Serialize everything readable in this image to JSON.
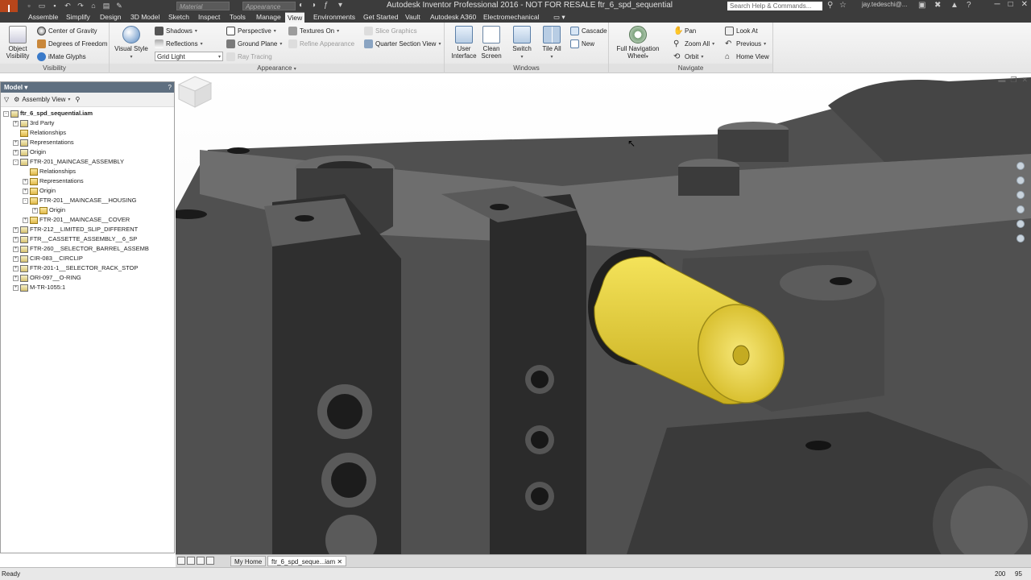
{
  "titlebar": {
    "logo": "I",
    "material_placeholder": "Material",
    "appearance_placeholder": "Appearance",
    "title": "Autodesk Inventor Professional 2016 - NOT FOR RESALE    ftr_6_spd_sequential",
    "search_placeholder": "Search Help & Commands...",
    "user": "jay.tedeschi@..."
  },
  "tabs": [
    "Assemble",
    "Simplify",
    "Design",
    "3D Model",
    "Sketch",
    "Inspect",
    "Tools",
    "Manage",
    "View",
    "Environments",
    "Get Started",
    "Vault",
    "Autodesk A360",
    "Electromechanical"
  ],
  "active_tab": "View",
  "ribbon": {
    "visibility": {
      "title": "Visibility",
      "object_visibility": "Object Visibility",
      "center_of_gravity": "Center of Gravity",
      "degrees_of_freedom": "Degrees of Freedom",
      "imate_glyphs": "iMate Glyphs"
    },
    "appearance": {
      "title": "Appearance",
      "visual_style": "Visual Style",
      "shadows": "Shadows",
      "reflections": "Reflections",
      "grid_light": "Grid Light",
      "perspective": "Perspective",
      "ground_plane": "Ground Plane",
      "ray_tracing": "Ray Tracing",
      "textures_on": "Textures On",
      "refine_appearance": "Refine Appearance",
      "slice_graphics": "Slice Graphics",
      "quarter_section_view": "Quarter Section View"
    },
    "windows": {
      "title": "Windows",
      "user_interface": "User Interface",
      "clean_screen": "Clean Screen",
      "switch": "Switch",
      "tile_all": "Tile All",
      "cascade": "Cascade",
      "new": "New"
    },
    "navigate": {
      "title": "Navigate",
      "full_navigation_wheel": "Full Navigation Wheel",
      "pan": "Pan",
      "zoom_all": "Zoom All",
      "orbit": "Orbit",
      "look_at": "Look At",
      "previous": "Previous",
      "home_view": "Home View"
    }
  },
  "browser": {
    "title": "Model",
    "view_mode": "Assembly View",
    "nodes": [
      {
        "label": "ftr_6_spd_sequential.iam",
        "level": 0,
        "pm": "-",
        "bold": true
      },
      {
        "label": "3rd Party",
        "level": 1,
        "pm": "+"
      },
      {
        "label": "Relationships",
        "level": 1,
        "pm": ""
      },
      {
        "label": "Representations",
        "level": 1,
        "pm": "+"
      },
      {
        "label": "Origin",
        "level": 1,
        "pm": "+"
      },
      {
        "label": "FTR-201_MAINCASE_ASSEMBLY",
        "level": 1,
        "pm": "-"
      },
      {
        "label": "Relationships",
        "level": 2,
        "pm": ""
      },
      {
        "label": "Representations",
        "level": 2,
        "pm": "+"
      },
      {
        "label": "Origin",
        "level": 2,
        "pm": "+"
      },
      {
        "label": "FTR-201__MAINCASE__HOUSING",
        "level": 2,
        "pm": "-"
      },
      {
        "label": "Origin",
        "level": 3,
        "pm": "+"
      },
      {
        "label": "FTR-201__MAINCASE__COVER",
        "level": 2,
        "pm": "+"
      },
      {
        "label": "FTR-212__LIMITED_SLIP_DIFFERENT",
        "level": 1,
        "pm": "+"
      },
      {
        "label": "FTR__CASSETTE_ASSEMBLY__6_SP",
        "level": 1,
        "pm": "+"
      },
      {
        "label": "FTR-260__SELECTOR_BARREL_ASSEMB",
        "level": 1,
        "pm": "+"
      },
      {
        "label": "CIR-083__CIRCLIP",
        "level": 1,
        "pm": "+"
      },
      {
        "label": "FTR-201-1__SELECTOR_RACK_STOP",
        "level": 1,
        "pm": "+"
      },
      {
        "label": "ORI-097__O-RING",
        "level": 1,
        "pm": "+"
      },
      {
        "label": "M-TR-1055:1",
        "level": 1,
        "pm": "+"
      }
    ]
  },
  "doctabs": {
    "home": "My Home",
    "document": "ftr_6_spd_seque...iam"
  },
  "status": {
    "text": "Ready",
    "count1": "200",
    "count2": "95"
  },
  "colors": {
    "highlight_part": "#e8d23a",
    "model_gray": "#4a4a4a",
    "titlebar": "#3c3c3c"
  }
}
